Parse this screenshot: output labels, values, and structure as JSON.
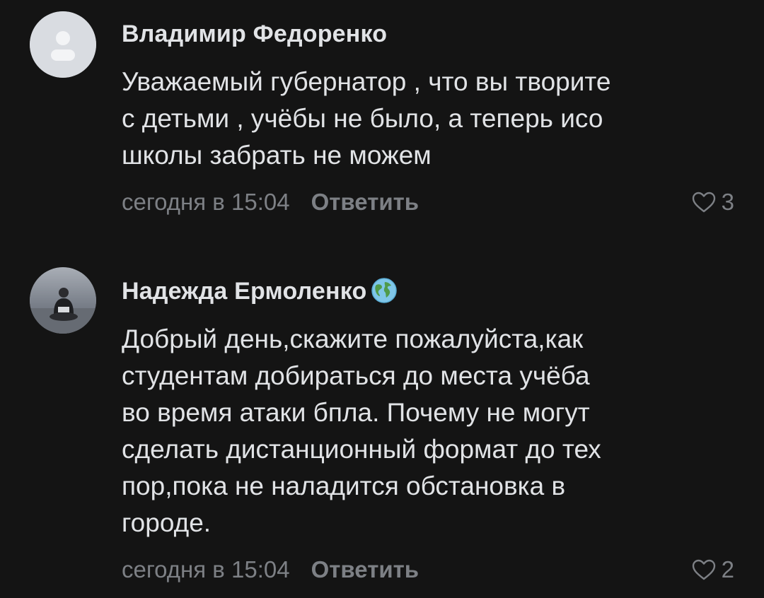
{
  "comments": [
    {
      "author": "Владимир Федоренко",
      "text": "Уважаемый губернатор , что вы творите\nс детьми , учёбы не было, а теперь исо\nшколы забрать не можем",
      "time": "сегодня в 15:04",
      "reply_label": "Ответить",
      "likes": "3",
      "avatar_icon": "default-user-avatar"
    },
    {
      "author": "Надежда Ермоленко",
      "author_badge_icon": "globe-emoji-icon",
      "text": "Добрый день,скажите пожалуйста,как\nстудентам добираться до места учёба\nво время атаки бпла. Почему не могут\nсделать дистанционный формат до тех\nпор,пока не наладится обстановка в\nгороде.",
      "time": "сегодня в 15:04",
      "reply_label": "Ответить",
      "likes": "2",
      "avatar_icon": "user-photo-avatar"
    }
  ],
  "colors": {
    "background": "#141414",
    "text": "#e1e3e6",
    "secondary": "#7d8085"
  }
}
